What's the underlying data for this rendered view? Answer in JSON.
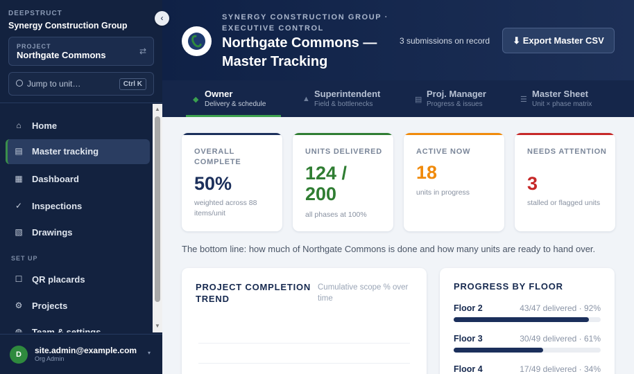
{
  "sidebar": {
    "brand": "DEEPSTRUCT",
    "org": "Synergy Construction Group",
    "collapse_icon": "‹",
    "project_label": "PROJECT",
    "project_name": "Northgate Commons",
    "swap_icon": "⇄",
    "jump_placeholder": "Jump to unit…",
    "jump_shortcut": "Ctrl K",
    "items": [
      {
        "icon": "⌂",
        "label": "Home"
      },
      {
        "icon": "▤",
        "label": "Master tracking"
      },
      {
        "icon": "▦",
        "label": "Dashboard"
      },
      {
        "icon": "✓",
        "label": "Inspections"
      },
      {
        "icon": "▧",
        "label": "Drawings"
      }
    ],
    "setup_section": "SET UP",
    "setup_items": [
      {
        "icon": "☐",
        "label": "QR placards"
      },
      {
        "icon": "⚙",
        "label": "Projects"
      },
      {
        "icon": "◍",
        "label": "Team & settings"
      }
    ],
    "user": {
      "initial": "D",
      "email": "site.admin@example.com",
      "role": "Org Admin",
      "chevron": "▾"
    }
  },
  "header": {
    "kicker": "SYNERGY CONSTRUCTION GROUP · EXECUTIVE CONTROL",
    "title": "Northgate Commons — Master Tracking",
    "submissions": "3 submissions on record",
    "export_label": "⬇ Export Master CSV"
  },
  "tabs": [
    {
      "icon": "◆",
      "name": "Owner",
      "sub": "Delivery & schedule"
    },
    {
      "icon": "▲",
      "name": "Superintendent",
      "sub": "Field & bottlenecks"
    },
    {
      "icon": "▤",
      "name": "Proj. Manager",
      "sub": "Progress & issues"
    },
    {
      "icon": "☰",
      "name": "Master Sheet",
      "sub": "Unit × phase matrix"
    }
  ],
  "kpis": [
    {
      "label": "OVERALL COMPLETE",
      "value": "50%",
      "note": "weighted across 88 items/unit",
      "color": "#1b2f5b"
    },
    {
      "label": "UNITS DELIVERED",
      "value": "124 / 200",
      "note": "all phases at 100%",
      "color": "#2f7d32"
    },
    {
      "label": "ACTIVE NOW",
      "value": "18",
      "note": "units in progress",
      "color": "#f08a0b"
    },
    {
      "label": "NEEDS ATTENTION",
      "value": "3",
      "note": "stalled or flagged units",
      "color": "#c62828"
    }
  ],
  "bottom_line": "The bottom line: how much of Northgate Commons is done and how many units are ready to hand over.",
  "trend": {
    "title": "PROJECT COMPLETION TREND",
    "subtitle": "Cumulative scope % over time"
  },
  "floors": {
    "title": "PROGRESS BY FLOOR",
    "rows": [
      {
        "name": "Floor 2",
        "stat": "43/47 delivered · 92%",
        "pct": 0.92
      },
      {
        "name": "Floor 3",
        "stat": "30/49 delivered · 61%",
        "pct": 0.61
      },
      {
        "name": "Floor 4",
        "stat": "17/49 delivered · 34%",
        "pct": 0.34
      }
    ]
  }
}
